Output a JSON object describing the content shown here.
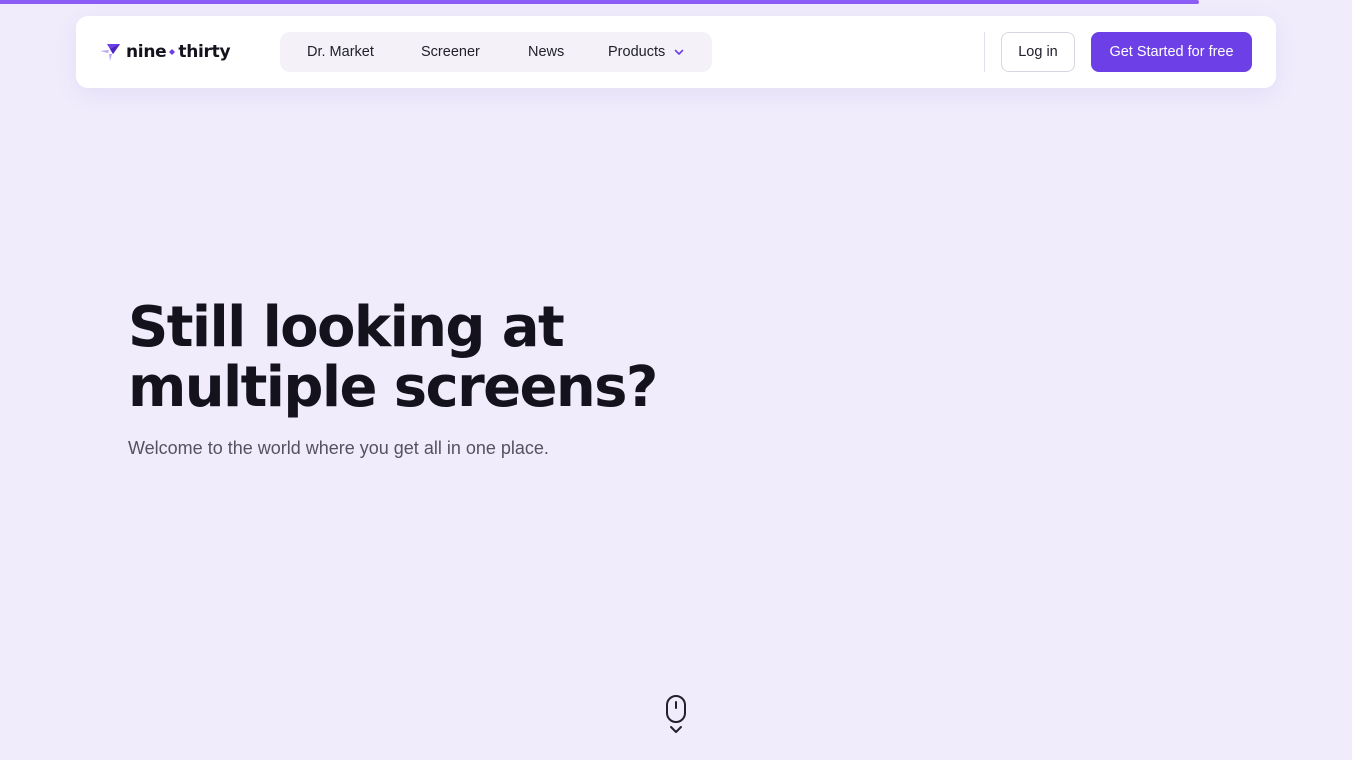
{
  "progress": {
    "fraction": 0.887,
    "color": "#8b5cf6"
  },
  "brand": {
    "name_left": "nine",
    "name_right": "thirty",
    "accent": "#6d3fe6"
  },
  "nav": {
    "items": [
      {
        "label": "Dr. Market"
      },
      {
        "label": "Screener"
      },
      {
        "label": "News"
      },
      {
        "label": "Products",
        "icon": "chevron-down-icon"
      }
    ]
  },
  "auth": {
    "login_label": "Log in",
    "cta_label": "Get Started for free"
  },
  "hero": {
    "title_line1": "Still looking at",
    "title_line2": "multiple screens?",
    "subtitle": "Welcome to the world where you get all in one place."
  },
  "scroll": {
    "icon": "mouse-scroll-icon"
  },
  "colors": {
    "background": "#f0ecfc",
    "primary": "#6d3fe6",
    "text": "#14121c"
  }
}
